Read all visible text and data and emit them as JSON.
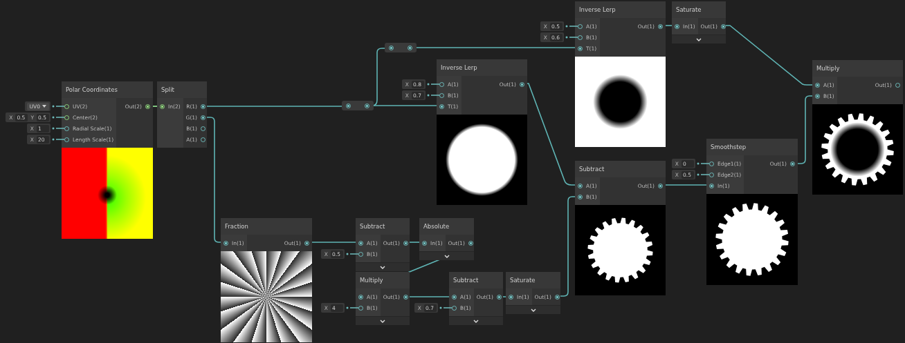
{
  "nodes": [
    {
      "title": "Polar Coordinates",
      "inputs": [
        {
          "label": "UV(2)",
          "kind": "vec2",
          "connected": false,
          "field": {
            "kind": "dropdown",
            "value": "UV0"
          }
        },
        {
          "label": "Center(2)",
          "kind": "vec2",
          "connected": false,
          "field": {
            "kind": "vector",
            "parts": [
              {
                "axis": "X",
                "value": "0.5"
              },
              {
                "axis": "Y",
                "value": "0.5"
              }
            ]
          }
        },
        {
          "label": "Radial Scale(1)",
          "kind": "float",
          "connected": false,
          "field": {
            "kind": "vector",
            "parts": [
              {
                "axis": "X",
                "value": "1"
              }
            ]
          }
        },
        {
          "label": "Length Scale(1)",
          "kind": "float",
          "connected": false,
          "field": {
            "kind": "vector",
            "parts": [
              {
                "axis": "X",
                "value": "20"
              }
            ]
          }
        }
      ],
      "outputs": [
        {
          "label": "Out(2)",
          "kind": "vec2",
          "connected": true
        }
      ],
      "preview": {
        "kind": "polar"
      }
    },
    {
      "title": "Split",
      "inputs": [
        {
          "label": "In(2)",
          "kind": "vec2",
          "connected": true
        }
      ],
      "outputs": [
        {
          "label": "R(1)",
          "kind": "float",
          "connected": true
        },
        {
          "label": "G(1)",
          "kind": "float",
          "connected": true
        },
        {
          "label": "B(1)",
          "kind": "float",
          "connected": false
        },
        {
          "label": "A(1)",
          "kind": "float",
          "connected": false
        }
      ]
    },
    {
      "title": "Inverse Lerp",
      "inputs": [
        {
          "label": "A(1)",
          "kind": "float",
          "connected": false,
          "field": {
            "kind": "vector",
            "parts": [
              {
                "axis": "X",
                "value": "0.8"
              }
            ]
          }
        },
        {
          "label": "B(1)",
          "kind": "float",
          "connected": false,
          "field": {
            "kind": "vector",
            "parts": [
              {
                "axis": "X",
                "value": "0.7"
              }
            ]
          }
        },
        {
          "label": "T(1)",
          "kind": "float",
          "connected": true
        }
      ],
      "outputs": [
        {
          "label": "Out(1)",
          "kind": "float",
          "connected": true
        }
      ],
      "preview": {
        "kind": "disc"
      }
    },
    {
      "title": "Inverse Lerp",
      "inputs": [
        {
          "label": "A(1)",
          "kind": "float",
          "connected": false,
          "field": {
            "kind": "vector",
            "parts": [
              {
                "axis": "X",
                "value": "0.5"
              }
            ]
          }
        },
        {
          "label": "B(1)",
          "kind": "float",
          "connected": false,
          "field": {
            "kind": "vector",
            "parts": [
              {
                "axis": "X",
                "value": "0.6"
              }
            ]
          }
        },
        {
          "label": "T(1)",
          "kind": "float",
          "connected": true
        }
      ],
      "outputs": [
        {
          "label": "Out(1)",
          "kind": "float",
          "connected": true
        }
      ],
      "preview": {
        "kind": "hole"
      }
    },
    {
      "title": "Saturate",
      "inputs": [
        {
          "label": "In(1)",
          "kind": "float",
          "connected": true
        }
      ],
      "outputs": [
        {
          "label": "Out(1)",
          "kind": "float",
          "connected": true
        }
      ],
      "expander": true
    },
    {
      "title": "Multiply",
      "inputs": [
        {
          "label": "A(1)",
          "kind": "float",
          "connected": true
        },
        {
          "label": "B(1)",
          "kind": "float",
          "connected": true
        }
      ],
      "outputs": [
        {
          "label": "Out(1)",
          "kind": "float",
          "connected": false
        }
      ],
      "preview": {
        "kind": "ring"
      }
    },
    {
      "title": "Subtract",
      "inputs": [
        {
          "label": "A(1)",
          "kind": "float",
          "connected": true
        },
        {
          "label": "B(1)",
          "kind": "float",
          "connected": true
        }
      ],
      "outputs": [
        {
          "label": "Out(1)",
          "kind": "float",
          "connected": true
        }
      ],
      "preview": {
        "kind": "gearsmall"
      }
    },
    {
      "title": "Smoothstep",
      "inputs": [
        {
          "label": "Edge1(1)",
          "kind": "float",
          "connected": false,
          "field": {
            "kind": "vector",
            "parts": [
              {
                "axis": "X",
                "value": "0"
              }
            ]
          }
        },
        {
          "label": "Edge2(1)",
          "kind": "float",
          "connected": false,
          "field": {
            "kind": "vector",
            "parts": [
              {
                "axis": "X",
                "value": "0.5"
              }
            ]
          }
        },
        {
          "label": "In(1)",
          "kind": "float",
          "connected": true
        }
      ],
      "outputs": [
        {
          "label": "Out(1)",
          "kind": "float",
          "connected": true
        }
      ],
      "preview": {
        "kind": "gear"
      }
    },
    {
      "title": "Fraction",
      "inputs": [
        {
          "label": "In(1)",
          "kind": "float",
          "connected": true
        }
      ],
      "outputs": [
        {
          "label": "Out(1)",
          "kind": "float",
          "connected": true
        }
      ],
      "preview": {
        "kind": "rays"
      }
    },
    {
      "title": "Subtract",
      "inputs": [
        {
          "label": "A(1)",
          "kind": "float",
          "connected": true
        },
        {
          "label": "B(1)",
          "kind": "float",
          "connected": false,
          "field": {
            "kind": "vector",
            "parts": [
              {
                "axis": "X",
                "value": "0.5"
              }
            ]
          }
        }
      ],
      "outputs": [
        {
          "label": "Out(1)",
          "kind": "float",
          "connected": true
        }
      ],
      "expander": true
    },
    {
      "title": "Absolute",
      "inputs": [
        {
          "label": "In(1)",
          "kind": "float",
          "connected": true
        }
      ],
      "outputs": [
        {
          "label": "Out(1)",
          "kind": "float",
          "connected": true
        }
      ],
      "expander": true
    },
    {
      "title": "Multiply",
      "inputs": [
        {
          "label": "A(1)",
          "kind": "float",
          "connected": true
        },
        {
          "label": "B(1)",
          "kind": "float",
          "connected": false,
          "field": {
            "kind": "vector",
            "parts": [
              {
                "axis": "X",
                "value": "4"
              }
            ]
          }
        }
      ],
      "outputs": [
        {
          "label": "Out(1)",
          "kind": "float",
          "connected": true
        }
      ],
      "expander": true
    },
    {
      "title": "Subtract",
      "inputs": [
        {
          "label": "A(1)",
          "kind": "float",
          "connected": true
        },
        {
          "label": "B(1)",
          "kind": "float",
          "connected": false,
          "field": {
            "kind": "vector",
            "parts": [
              {
                "axis": "X",
                "value": "0.7"
              }
            ]
          }
        }
      ],
      "outputs": [
        {
          "label": "Out(1)",
          "kind": "float",
          "connected": true
        }
      ],
      "expander": true
    },
    {
      "title": "Saturate",
      "inputs": [
        {
          "label": "In(1)",
          "kind": "float",
          "connected": true
        }
      ],
      "outputs": [
        {
          "label": "Out(1)",
          "kind": "float",
          "connected": true
        }
      ],
      "expander": true
    }
  ]
}
